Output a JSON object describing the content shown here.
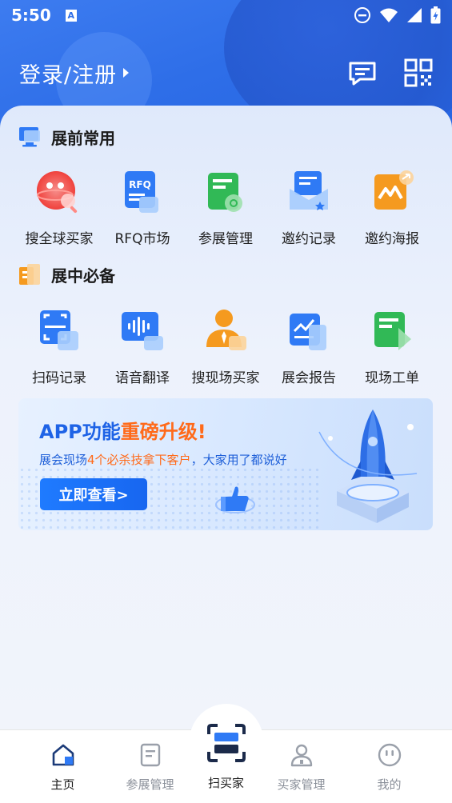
{
  "status_bar": {
    "time": "5:50",
    "indicator": "A"
  },
  "header": {
    "login_label": "登录/注册"
  },
  "sections": [
    {
      "title": "展前常用",
      "items": [
        {
          "label": "搜全球买家",
          "icon": "globe-search-icon"
        },
        {
          "label": "RFQ市场",
          "icon": "rfq-icon",
          "icon_text": "RFQ"
        },
        {
          "label": "参展管理",
          "icon": "exhibit-manage-icon"
        },
        {
          "label": "邀约记录",
          "icon": "invite-record-icon"
        },
        {
          "label": "邀约海报",
          "icon": "invite-poster-icon"
        }
      ]
    },
    {
      "title": "展中必备",
      "items": [
        {
          "label": "扫码记录",
          "icon": "scan-record-icon"
        },
        {
          "label": "语音翻译",
          "icon": "voice-translate-icon"
        },
        {
          "label": "搜现场买家",
          "icon": "onsite-buyer-icon"
        },
        {
          "label": "展会报告",
          "icon": "expo-report-icon"
        },
        {
          "label": "现场工单",
          "icon": "onsite-ticket-icon"
        }
      ]
    }
  ],
  "banner": {
    "title_part1": "APP功能",
    "title_part2": "重磅升级!",
    "sub_part1": "展会现场",
    "sub_part2": "4个必杀技拿下客户",
    "sub_part3": "，大家用了都说好",
    "button_label": "立即查看>"
  },
  "bottom_nav": [
    {
      "label": "主页",
      "icon": "home-icon",
      "active": true
    },
    {
      "label": "参展管理",
      "icon": "document-icon",
      "active": false
    },
    {
      "label": "扫买家",
      "icon": "scan-icon",
      "active": true
    },
    {
      "label": "买家管理",
      "icon": "person-icon",
      "active": false
    },
    {
      "label": "我的",
      "icon": "profile-icon",
      "active": false
    }
  ],
  "colors": {
    "brand_blue": "#2e6ee8",
    "accent_orange": "#ff6a1a"
  }
}
